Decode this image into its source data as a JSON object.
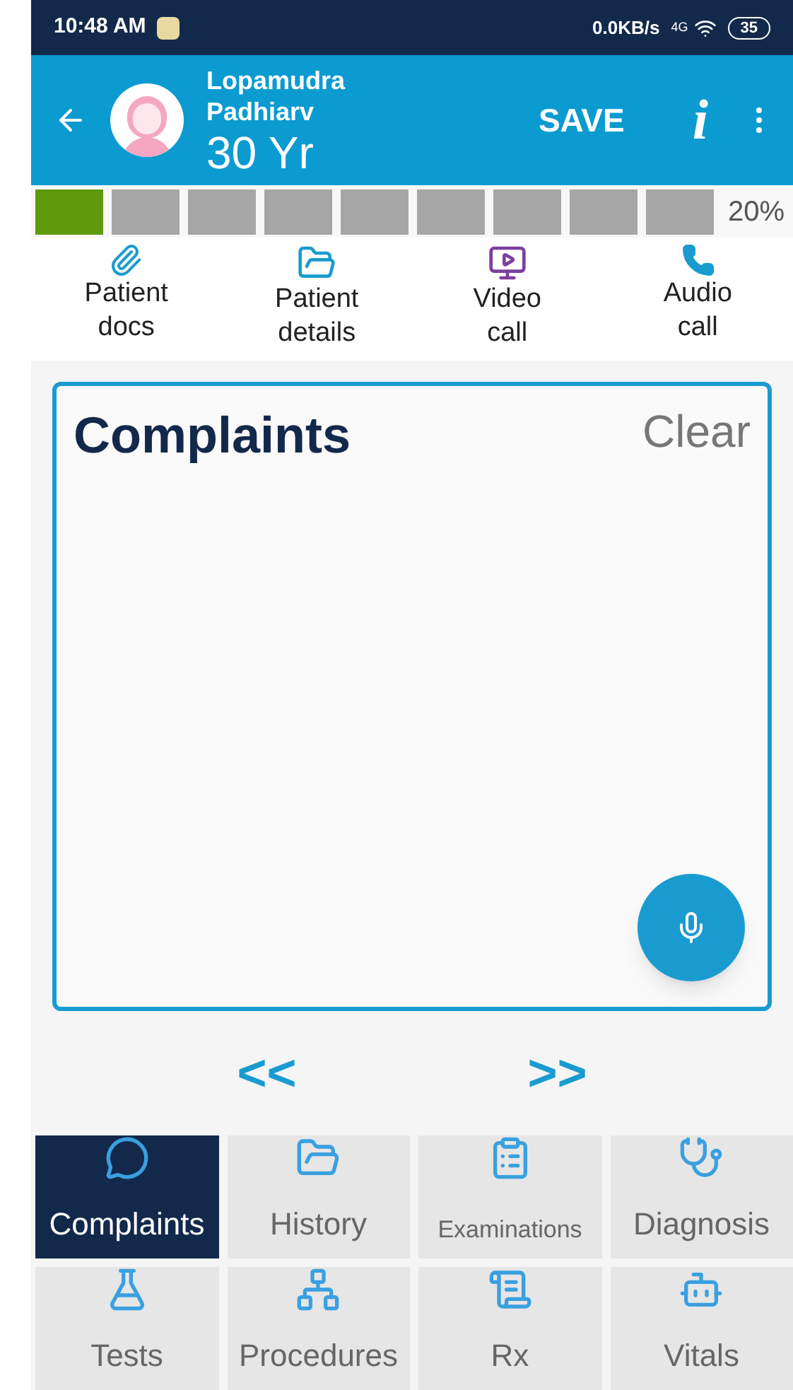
{
  "status_bar": {
    "time": "10:48 AM",
    "speed": "0.0KB/s",
    "network": "4G",
    "battery": "35"
  },
  "header": {
    "name": [
      "Lopamudra",
      "Padhiarv"
    ],
    "age": "30 Yr",
    "save": "SAVE",
    "info": "i"
  },
  "progress": {
    "segments": [
      {
        "filled": true
      },
      {
        "filled": false
      },
      {
        "filled": false
      },
      {
        "filled": false
      },
      {
        "filled": false
      },
      {
        "filled": false
      },
      {
        "filled": false
      },
      {
        "filled": false
      },
      {
        "filled": false
      }
    ],
    "reading": "20%"
  },
  "actions": [
    {
      "kind": "docs",
      "label": [
        "Patient",
        "docs"
      ]
    },
    {
      "kind": "details",
      "label": [
        "Patient",
        "details"
      ]
    },
    {
      "kind": "video",
      "label": [
        "Video",
        "call"
      ]
    },
    {
      "kind": "audio",
      "label": [
        "Audio",
        "call"
      ]
    }
  ],
  "editor": {
    "title": "Complaints",
    "clear": "Clear"
  },
  "nav": {
    "prev": "<<",
    "next": ">>"
  },
  "sections": [
    {
      "label": "Complaints",
      "kind": "complaints",
      "selected": true
    },
    {
      "label": "History",
      "kind": "history",
      "selected": false
    },
    {
      "label": "Examinations",
      "kind": "examinations",
      "selected": false
    },
    {
      "label": "Diagnosis",
      "kind": "diagnosis",
      "selected": false
    },
    {
      "label": "Tests",
      "kind": "tests",
      "selected": false
    },
    {
      "label": "Procedures",
      "kind": "procedures",
      "selected": false
    },
    {
      "label": "Rx",
      "kind": "rx",
      "selected": false
    },
    {
      "label": "Vitals",
      "kind": "vitals",
      "selected": false
    }
  ]
}
